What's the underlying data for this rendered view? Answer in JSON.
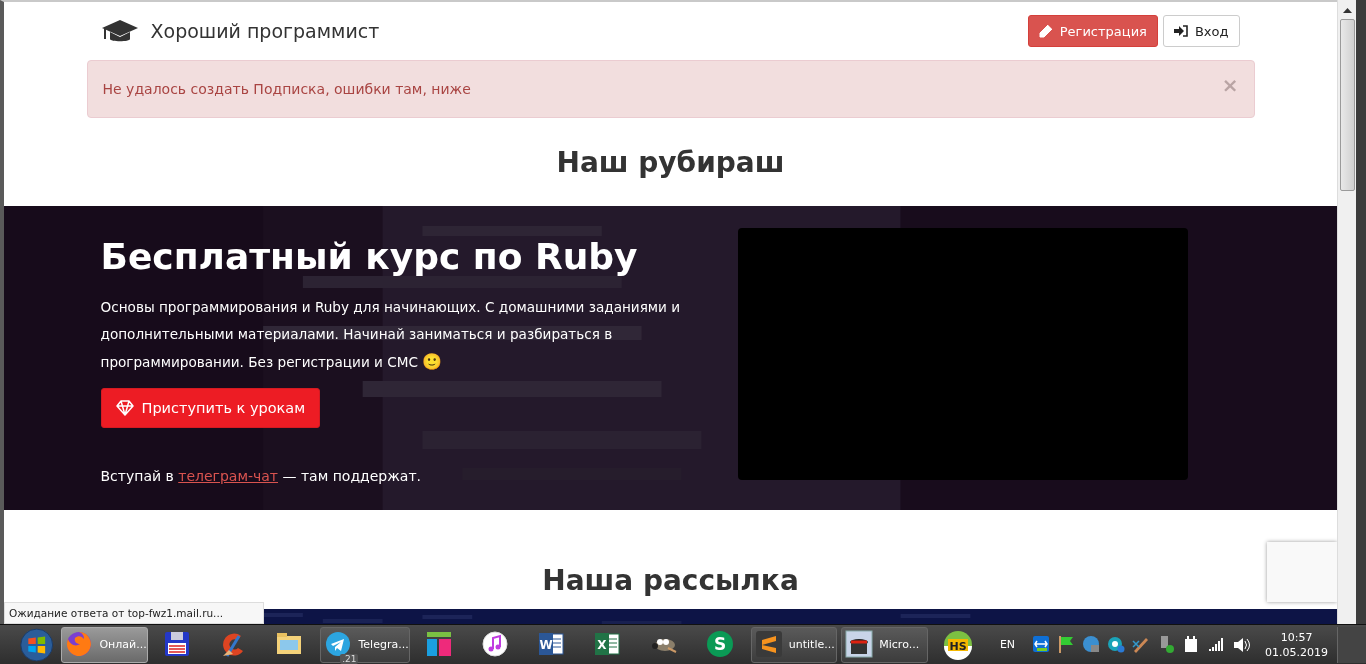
{
  "site": {
    "brand": "Хороший программист",
    "buttons": [
      {
        "label": "Регистрация",
        "kind": "primary"
      },
      {
        "label": "Вход",
        "kind": "default"
      }
    ]
  },
  "alert": {
    "message": "Не удалось создать Подписка, ошибки там, ниже",
    "close": "×"
  },
  "section_title": "Наш рубираш",
  "hero": {
    "title": "Бесплатный курс по Ruby",
    "text": "Основы программирования и Ruby для начинающих. С домашними заданиями и дополнительными материалами. Начинай заниматься и разбираться в программировании. Без регистрации и СМС",
    "emoji": "🙂",
    "button": "Приступить к урокам",
    "note_before": "Вступай в",
    "note_link": "телеграм-чат",
    "note_after": "— там поддержат."
  },
  "newsletter_title": "Наша рассылка",
  "status_text": "Ожидание ответа от top-fwz1.mail.ru...",
  "taskbar": {
    "items": [
      {
        "kind": "window",
        "label": "Онлай...",
        "active": true
      },
      {
        "kind": "pinned"
      },
      {
        "kind": "pinned"
      },
      {
        "kind": "pinned"
      },
      {
        "kind": "window",
        "label": "Telegra...",
        "badge": ".21",
        "active": false
      },
      {
        "kind": "pinned"
      },
      {
        "kind": "pinned"
      },
      {
        "kind": "pinned",
        "glyph": "W"
      },
      {
        "kind": "pinned",
        "glyph": "X"
      },
      {
        "kind": "pinned"
      },
      {
        "kind": "pinned",
        "glyph": "S"
      },
      {
        "kind": "window",
        "label": "untitle...",
        "active": false
      },
      {
        "kind": "window",
        "label": "Micro...",
        "active": false
      },
      {
        "kind": "pinned",
        "glyph": "HS"
      }
    ],
    "language": "EN",
    "time": "10:57",
    "date": "01.05.2019"
  }
}
